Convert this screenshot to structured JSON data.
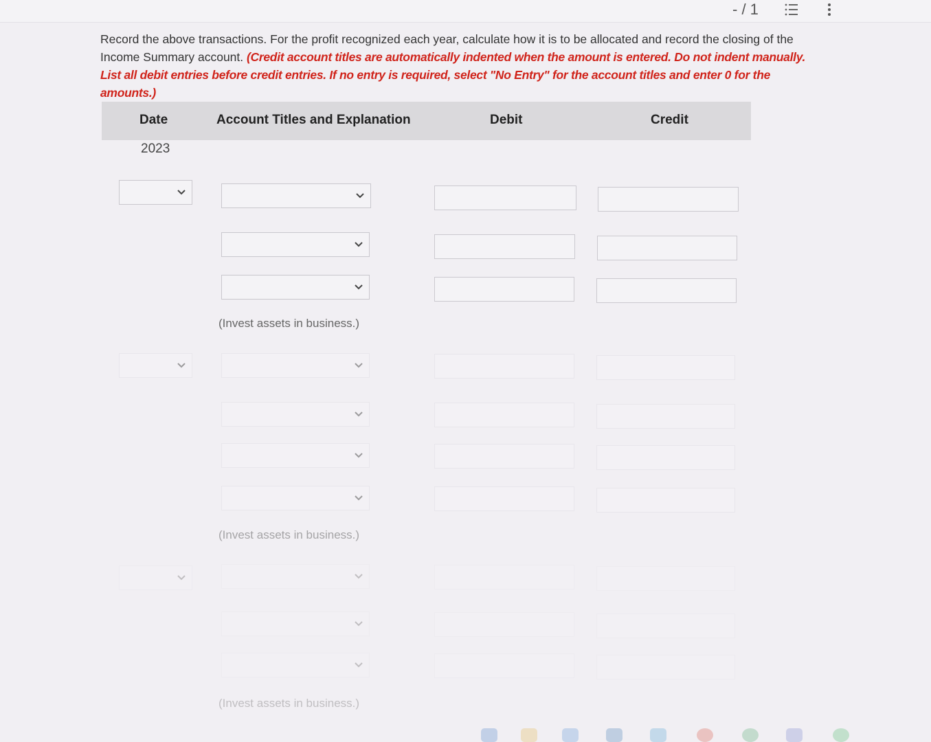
{
  "toolbar": {
    "page_indicator": "- / 1",
    "outline_icon": "outline-icon",
    "more_icon": "more-vertical-icon"
  },
  "instructions": {
    "text": "Record the above transactions. For the profit recognized each year, calculate how it is to be allocated and record the closing of the Income Summary account. ",
    "emphasis": "(Credit account titles are automatically indented when the amount is entered. Do not indent manually. List all debit entries before credit entries. If no entry is required, select \"No Entry\" for the account titles and enter 0 for the amounts.)"
  },
  "table": {
    "headers": {
      "date": "Date",
      "account": "Account Titles and Explanation",
      "debit": "Debit",
      "credit": "Credit"
    },
    "year": "2023",
    "entries": [
      {
        "explanation": "(Invest assets in business.)"
      },
      {
        "explanation": "(Invest assets in business.)"
      },
      {
        "explanation": "(Invest assets in business.)"
      }
    ]
  },
  "colors": {
    "instruction_red": "#d0241b",
    "header_bg": "#dad9dc"
  }
}
